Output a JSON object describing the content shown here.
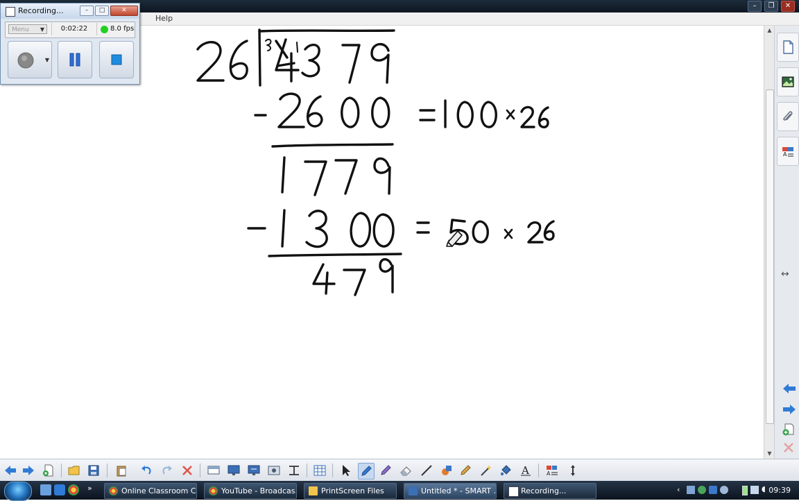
{
  "recorder": {
    "title": "Recording...",
    "menu_label": "Menu",
    "elapsed": "0:02:22",
    "fps": "8.0 fps",
    "status_color": "#20d020"
  },
  "menu": {
    "visible_item": "Help"
  },
  "whiteboard": {
    "divisor": "26",
    "dividend": "4379",
    "dividend_corrections": "3 1",
    "step1_subtract": "2600",
    "step1_note": "=100 × 26",
    "remainder1": "1779",
    "step2_subtract": "1300",
    "step2_note": "= 50 × 26",
    "remainder2": "479"
  },
  "sidebar": {
    "tabs": [
      "page-sorter-icon",
      "gallery-icon",
      "attachments-icon",
      "properties-icon"
    ],
    "arrows": "↔"
  },
  "toolbar": {
    "icons": [
      "back-arrow-icon",
      "forward-arrow-icon",
      "add-page-icon",
      "open-icon",
      "save-icon",
      "paste-icon",
      "undo-icon",
      "redo-icon",
      "delete-icon",
      "screen-shade-icon",
      "full-screen-icon",
      "dual-display-icon",
      "screen-capture-icon",
      "toggle-icon",
      "table-icon",
      "select-icon",
      "pen-icon",
      "creative-pen-icon",
      "eraser-icon",
      "line-icon",
      "shapes-icon",
      "magic-pen-icon",
      "wand-icon",
      "fill-icon",
      "text-icon",
      "properties-icon",
      "move-toolbar-icon"
    ]
  },
  "taskbar": {
    "tasks": [
      {
        "label": "Online Classroom C..."
      },
      {
        "label": "YouTube - Broadcas..."
      },
      {
        "label": "PrintScreen Files"
      },
      {
        "label": "Untitled * - SMART ..."
      },
      {
        "label": "Recording..."
      }
    ],
    "clock": "09:39",
    "overflow": "»"
  }
}
